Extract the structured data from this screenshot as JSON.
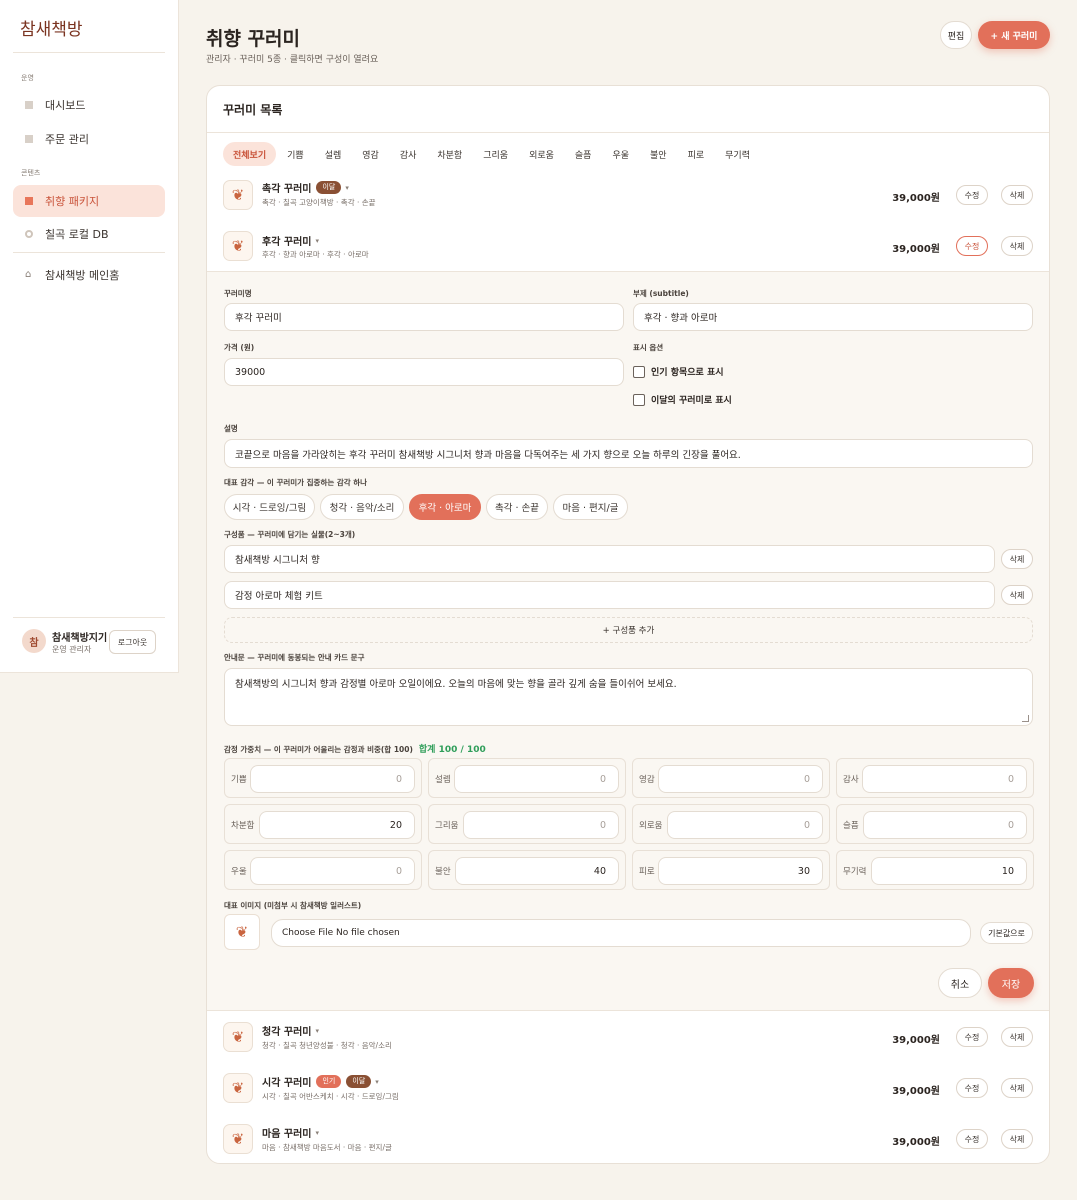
{
  "sidebar": {
    "brand": "참새책방",
    "section_ops": "운영",
    "section_content": "콘텐츠",
    "items": [
      {
        "label": "대시보드"
      },
      {
        "label": "주문 관리"
      },
      {
        "label": "취향 패키지"
      },
      {
        "label": "칠곡 로컬 DB"
      },
      {
        "label": "참새책방 메인홈"
      }
    ],
    "user": {
      "avatar": "참",
      "name": "참새책방지기",
      "role": "운영 관리자",
      "logout": "로그아웃"
    }
  },
  "header": {
    "title": "취향 꾸러미",
    "subtitle": "관리자 · 꾸러미 5종 · 클릭하면 구성이 열려요",
    "edit": "편집",
    "new": "+ 새 꾸러미"
  },
  "list": {
    "title": "꾸러미 목록",
    "tabs": [
      "전체보기",
      "기쁨",
      "설렘",
      "영감",
      "감사",
      "차분함",
      "그리움",
      "외로움",
      "슬픔",
      "우울",
      "불안",
      "피로",
      "무기력"
    ],
    "edit_label": "수정",
    "delete_label": "삭제",
    "caret": "▾",
    "rows": [
      {
        "name": "촉각 꾸러미",
        "badges": [
          {
            "text": "이달",
            "kind": "month"
          }
        ],
        "sub": "촉각 · 칠곡 고양이책방 · 촉각 · 손끝",
        "price": "39,000원"
      },
      {
        "name": "후각 꾸러미",
        "badges": [],
        "sub": "후각 · 향과 아로마 · 후각 · 아로마",
        "price": "39,000원"
      },
      {
        "name": "청각 꾸러미",
        "badges": [],
        "sub": "청각 · 칠곡 청년양성불 · 청각 · 음악/소리",
        "price": "39,000원"
      },
      {
        "name": "시각 꾸러미",
        "badges": [
          {
            "text": "인기",
            "kind": "pop"
          },
          {
            "text": "이달",
            "kind": "month"
          }
        ],
        "sub": "시각 · 칠곡 어반스케치 · 시각 · 드로잉/그림",
        "price": "39,000원"
      },
      {
        "name": "마음 꾸러미",
        "badges": [],
        "sub": "마음 · 참새책방 마음도서 · 마음 · 편지/글",
        "price": "39,000원"
      }
    ]
  },
  "editor": {
    "name_label": "꾸러미명",
    "name_value": "후각 꾸러미",
    "subtitle_label": "부제 (subtitle)",
    "subtitle_value": "후각 · 향과 아로마",
    "price_label": "가격 (원)",
    "price_value": "39000",
    "display_label": "표시 옵션",
    "popular_label": "인기 항목으로 표시",
    "monthly_label": "이달의 꾸러미로 표시",
    "desc_label": "설명",
    "desc_value": "코끝으로 마음을 가라앉히는 후각 꾸러미 참새책방 시그니처 향과 마음을 다독여주는 세 가지 향으로 오늘 하루의 긴장을 풀어요.",
    "sense_label": "대표 감각 — 이 꾸러미가 집중하는 감각 하나",
    "senses": [
      "시각 · 드로잉/그림",
      "청각 · 음악/소리",
      "후각 · 아로마",
      "촉각 · 손끝",
      "마음 · 편지/글"
    ],
    "sense_selected": "후각 · 아로마",
    "components_label": "구성품 — 꾸러미에 담기는 실물(2~3개)",
    "components": [
      "참새책방 시그니처 향",
      "감정 아로마 체험 키트"
    ],
    "component_delete": "삭제",
    "add_component": "+ 구성품 추가",
    "guide_label": "안내문 — 꾸러미에 동봉되는 안내 카드 문구",
    "guide_value": "참새책방의 시그니처 향과 감정별 아로마 오일이에요. 오늘의 마음에 맞는 향을 골라 깊게 숨을 들이쉬어 보세요.",
    "weights_label": "감정 가중치 — 이 꾸러미가 어울리는 감정과 비중(합 100)",
    "weights_total": "합계 100 / 100",
    "weights": [
      {
        "label": "기쁨",
        "value": "0"
      },
      {
        "label": "설렘",
        "value": "0"
      },
      {
        "label": "영감",
        "value": "0"
      },
      {
        "label": "감사",
        "value": "0"
      },
      {
        "label": "차분함",
        "value": "20"
      },
      {
        "label": "그리움",
        "value": "0"
      },
      {
        "label": "외로움",
        "value": "0"
      },
      {
        "label": "슬픔",
        "value": "0"
      },
      {
        "label": "우울",
        "value": "0"
      },
      {
        "label": "불안",
        "value": "40"
      },
      {
        "label": "피로",
        "value": "30"
      },
      {
        "label": "무기력",
        "value": "10"
      }
    ],
    "image_label": "대표 이미지 (미첨부 시 참새책방 일러스트)",
    "file_text": "Choose File  No file chosen",
    "reset": "기본값으로",
    "cancel": "취소",
    "save": "저장"
  },
  "colors": {
    "accent": "#e2705a",
    "accent_soft": "#fbe3da",
    "badge_month": "#8a5034",
    "ok_green": "#2f9e5a"
  },
  "icons": {
    "thumb": "bird-illustration-icon"
  }
}
